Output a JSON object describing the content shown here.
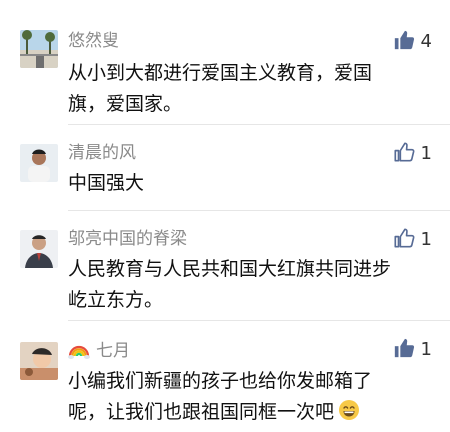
{
  "comments": [
    {
      "username": "悠然叟",
      "text": "从小到大都进行爱国主义教育，爱国旗，爱国家。",
      "likes": "4",
      "liked": true
    },
    {
      "username": "清晨的风",
      "text": "中国强大",
      "likes": "1",
      "liked": false
    },
    {
      "username": "邬亮中国的脊梁",
      "text": "人民教育与人民共和国大红旗共同进步屹立东方。",
      "likes": "1",
      "liked": false
    },
    {
      "username": "七月",
      "username_prefix_icon": "rainbow-emoji-icon",
      "text": "小编我们新疆的孩子也给你发邮箱了呢，让我们也跟祖国同框一次吧",
      "text_suffix_icon": "grinning-emoji-icon",
      "likes": "1",
      "liked": true
    }
  ],
  "colors": {
    "like_active": "#576b95",
    "name": "#8a8a8a",
    "text": "#111111"
  }
}
